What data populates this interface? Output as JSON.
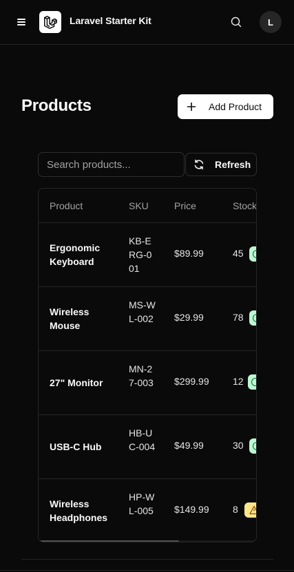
{
  "header": {
    "app_title": "Laravel Starter Kit",
    "avatar_initial": "L"
  },
  "page": {
    "title": "Products",
    "add_button_label": "Add Product"
  },
  "toolbar": {
    "search_placeholder": "Search products...",
    "search_value": "",
    "refresh_label": "Refresh"
  },
  "table": {
    "columns": [
      "Product",
      "SKU",
      "Price",
      "Stock"
    ],
    "rows": [
      {
        "name": "Ergonomic Keyboard",
        "sku": "KB-ERG-001",
        "price": "$89.99",
        "stock": "45",
        "status": "ok"
      },
      {
        "name": "Wireless Mouse",
        "sku": "MS-WL-002",
        "price": "$29.99",
        "stock": "78",
        "status": "ok"
      },
      {
        "name": "27\" Monitor",
        "sku": "MN-27-003",
        "price": "$299.99",
        "stock": "12",
        "status": "ok"
      },
      {
        "name": "USB-C Hub",
        "sku": "HB-UC-004",
        "price": "$49.99",
        "stock": "30",
        "status": "ok"
      },
      {
        "name": "Wireless Headphones",
        "sku": "HP-WL-005",
        "price": "$149.99",
        "stock": "8",
        "status": "warn"
      }
    ]
  },
  "icons": {
    "menu": "menu-icon",
    "logo": "laravel-logo-icon",
    "search": "search-icon",
    "plus": "plus-icon",
    "refresh": "refresh-icon",
    "in_stock": "check-circle-icon",
    "low_stock": "warning-triangle-icon"
  },
  "colors": {
    "background": "#0a0a0a",
    "border": "#262626",
    "in_stock_badge": "#bbf7d0",
    "low_stock_badge": "#fde68a"
  }
}
